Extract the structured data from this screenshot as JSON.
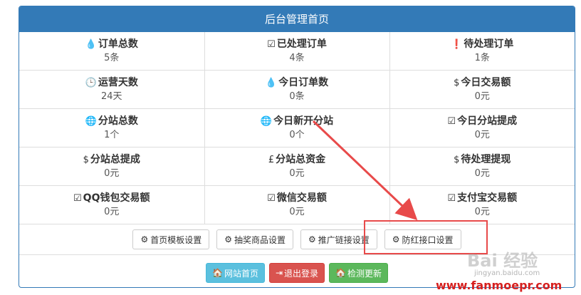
{
  "panel": {
    "title": "后台管理首页"
  },
  "stats": [
    [
      {
        "icon": "💧",
        "icon_name": "droplet-icon",
        "label": "订单总数",
        "value": "5条"
      },
      {
        "icon": "☑",
        "icon_name": "check-square-icon",
        "label": "已处理订单",
        "value": "4条"
      },
      {
        "icon": "❗",
        "icon_name": "exclamation-circle-icon",
        "label": "待处理订单",
        "value": "1条"
      }
    ],
    [
      {
        "icon": "🕒",
        "icon_name": "clock-icon",
        "label": "运营天数",
        "value": "24天"
      },
      {
        "icon": "💧",
        "icon_name": "droplet-icon",
        "label": "今日订单数",
        "value": "0条"
      },
      {
        "icon": "$",
        "icon_name": "dollar-icon",
        "label": "今日交易额",
        "value": "0元"
      }
    ],
    [
      {
        "icon": "🌐",
        "icon_name": "globe-icon",
        "label": "分站总数",
        "value": "1个"
      },
      {
        "icon": "🌐",
        "icon_name": "globe-icon",
        "label": "今日新开分站",
        "value": "0个"
      },
      {
        "icon": "☑",
        "icon_name": "check-square-icon",
        "label": "今日分站提成",
        "value": "0元"
      }
    ],
    [
      {
        "icon": "$",
        "icon_name": "dollar-icon",
        "label": "分站总提成",
        "value": "0元"
      },
      {
        "icon": "£",
        "icon_name": "gbp-icon",
        "label": "分站总资金",
        "value": "0元"
      },
      {
        "icon": "$",
        "icon_name": "dollar-icon",
        "label": "待处理提现",
        "value": "0元"
      }
    ],
    [
      {
        "icon": "☑",
        "icon_name": "check-square-icon",
        "label": "QQ钱包交易额",
        "value": "0元"
      },
      {
        "icon": "☑",
        "icon_name": "check-square-icon",
        "label": "微信交易额",
        "value": "0元"
      },
      {
        "icon": "☑",
        "icon_name": "check-square-icon",
        "label": "支付宝交易额",
        "value": "0元"
      }
    ]
  ],
  "settings_buttons": [
    {
      "icon": "⚙",
      "icon_name": "gear-icon",
      "label": "首页模板设置"
    },
    {
      "icon": "⚙",
      "icon_name": "gear-icon",
      "label": "抽奖商品设置"
    },
    {
      "icon": "⚙",
      "icon_name": "gear-icon",
      "label": "推广链接设置"
    },
    {
      "icon": "⚙",
      "icon_name": "gear-icon",
      "label": "防红接口设置"
    }
  ],
  "nav_buttons": {
    "home": {
      "icon": "🏠",
      "icon_name": "home-icon",
      "label": "网站首页",
      "color": "#5bc0de"
    },
    "logout": {
      "icon": "⇥",
      "icon_name": "sign-out-icon",
      "label": "退出登录",
      "color": "#d9534f"
    },
    "update": {
      "icon": "🏠",
      "icon_name": "home-icon",
      "label": "检测更新",
      "color": "#5cb85c"
    }
  },
  "watermarks": {
    "baidu": "Bai 经验",
    "jingyan": "jingyan.baidu.com",
    "site": "www.fanmoepr.com"
  },
  "colors": {
    "primary": "#337ab7",
    "annotation_red": "#e84a4a"
  }
}
